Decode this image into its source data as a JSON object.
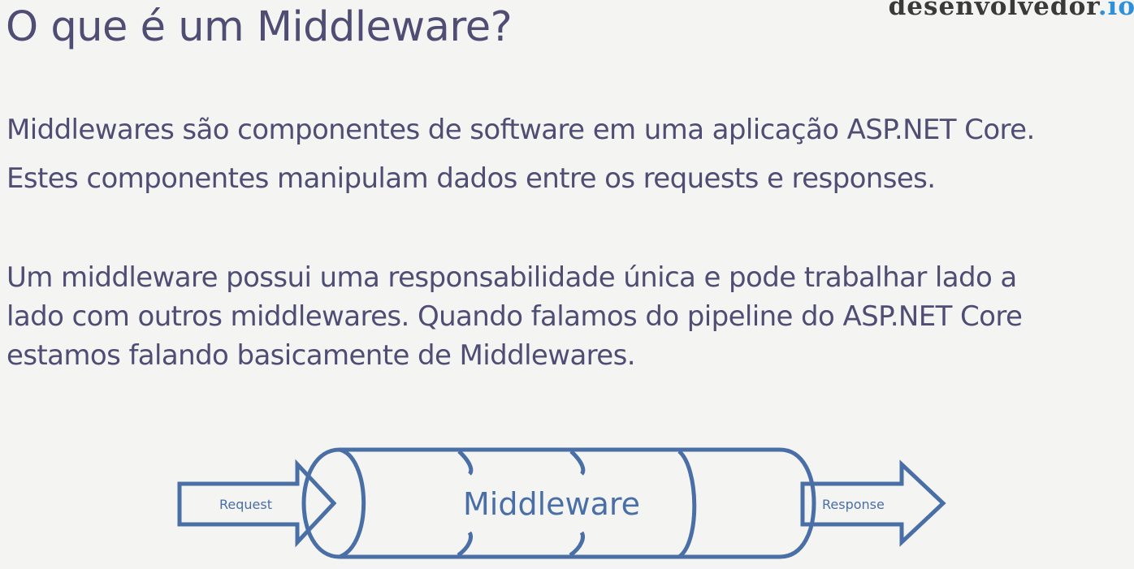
{
  "brand": {
    "name": "desenvolvedor",
    "tld": ".io"
  },
  "slide": {
    "title": "O que é um Middleware?",
    "paragraph1": [
      "Middlewares são componentes de software em uma aplicação ASP.NET Core.",
      "Estes componentes manipulam dados entre os requests e responses."
    ],
    "paragraph2": [
      "Um middleware possui uma responsabilidade única e pode trabalhar lado a",
      "lado com outros middlewares. Quando falamos do pipeline do ASP.NET Core",
      "estamos falando basicamente de Middlewares."
    ]
  },
  "diagram": {
    "request_label": "Request",
    "middleware_label": "Middleware",
    "response_label": "Response",
    "stroke_color": "#4a6fa6"
  }
}
